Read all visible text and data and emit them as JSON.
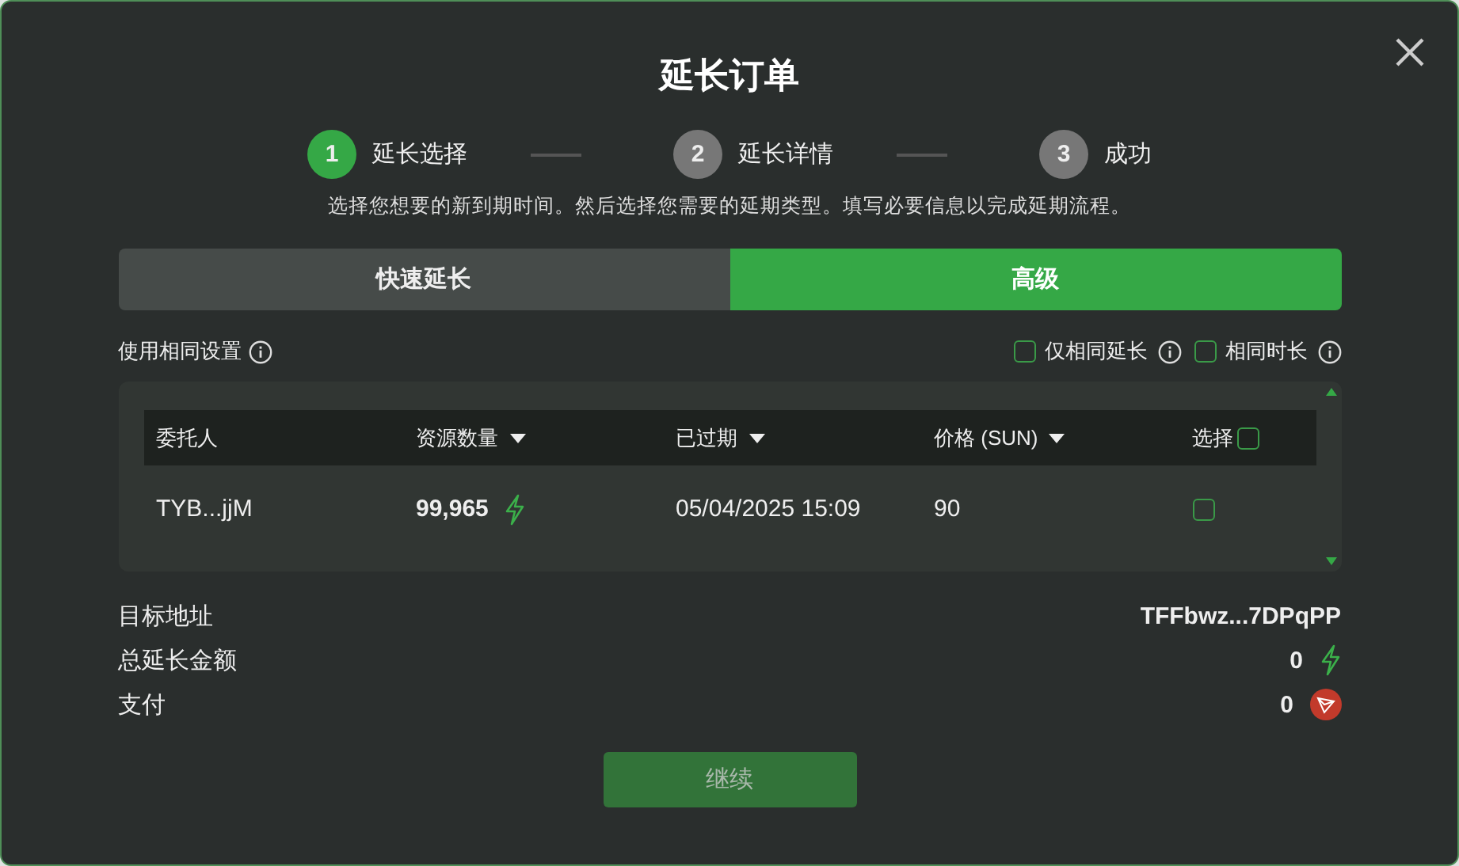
{
  "dialog": {
    "title": "延长订单"
  },
  "steps": [
    {
      "number": "1",
      "label": "延长选择",
      "selected": true
    },
    {
      "number": "2",
      "label": "延长详情",
      "selected": false
    },
    {
      "number": "3",
      "label": "成功",
      "selected": false
    }
  ],
  "subtitle": "选择您想要的新到期时间。然后选择您需要的延期类型。填写必要信息以完成延期流程。",
  "tabs": [
    {
      "label": "快速延长",
      "selected": false
    },
    {
      "label": "高级",
      "selected": true
    }
  ],
  "same_settings": {
    "label": "使用相同设置"
  },
  "options": [
    {
      "label": "仅相同延长",
      "checked": false
    },
    {
      "label": "相同时长",
      "checked": false
    }
  ],
  "table": {
    "columns": [
      {
        "label": "委托人",
        "kind": "plain"
      },
      {
        "label": "资源数量",
        "kind": "sort"
      },
      {
        "label": "已过期",
        "kind": "sort"
      },
      {
        "label": "价格 (SUN)",
        "kind": "sort"
      },
      {
        "label": "选择",
        "kind": "checkbox",
        "checked": false
      }
    ],
    "rows": [
      {
        "delegator": "TYB...jjM",
        "amount": "99,965",
        "expired": "05/04/2025 15:09",
        "price": "90",
        "checked": false
      }
    ]
  },
  "summary": [
    {
      "label": "目标地址",
      "value": "TFFbwz...7DPqPP",
      "kind": "address"
    },
    {
      "label": "总延长金额",
      "value": "0",
      "kind": "energy"
    },
    {
      "label": "支付",
      "value": "0",
      "kind": "trx"
    }
  ],
  "button": {
    "label": "继续",
    "disabled": true
  }
}
